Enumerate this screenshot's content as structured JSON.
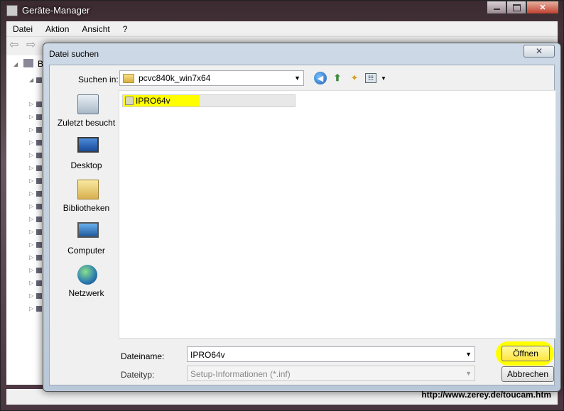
{
  "parent_window": {
    "title": "Geräte-Manager",
    "menu": [
      "Datei",
      "Aktion",
      "Ansicht",
      "?"
    ],
    "tree_first_label": "B"
  },
  "dialog": {
    "title": "Datei suchen",
    "close_glyph": "✕",
    "look_in_label": "Suchen in:",
    "look_in_value": "pcvc840k_win7x64",
    "places": [
      {
        "label": "Zuletzt besucht",
        "icon": "recent-places-icon"
      },
      {
        "label": "Desktop",
        "icon": "desktop-icon"
      },
      {
        "label": "Bibliotheken",
        "icon": "libraries-icon"
      },
      {
        "label": "Computer",
        "icon": "computer-icon"
      },
      {
        "label": "Netzwerk",
        "icon": "network-icon"
      }
    ],
    "files": [
      {
        "name": "IPRO64v",
        "icon": "setup-information-file-icon"
      }
    ],
    "filename_label": "Dateiname:",
    "filename_value": "IPRO64v",
    "filetype_label": "Dateityp:",
    "filetype_value": "Setup-Informationen (*.inf)",
    "open_button": "Öffnen",
    "cancel_button": "Abbrechen",
    "highlight_color": "#ffff00"
  },
  "watermark": "http://www.zerey.de/toucam.htm"
}
